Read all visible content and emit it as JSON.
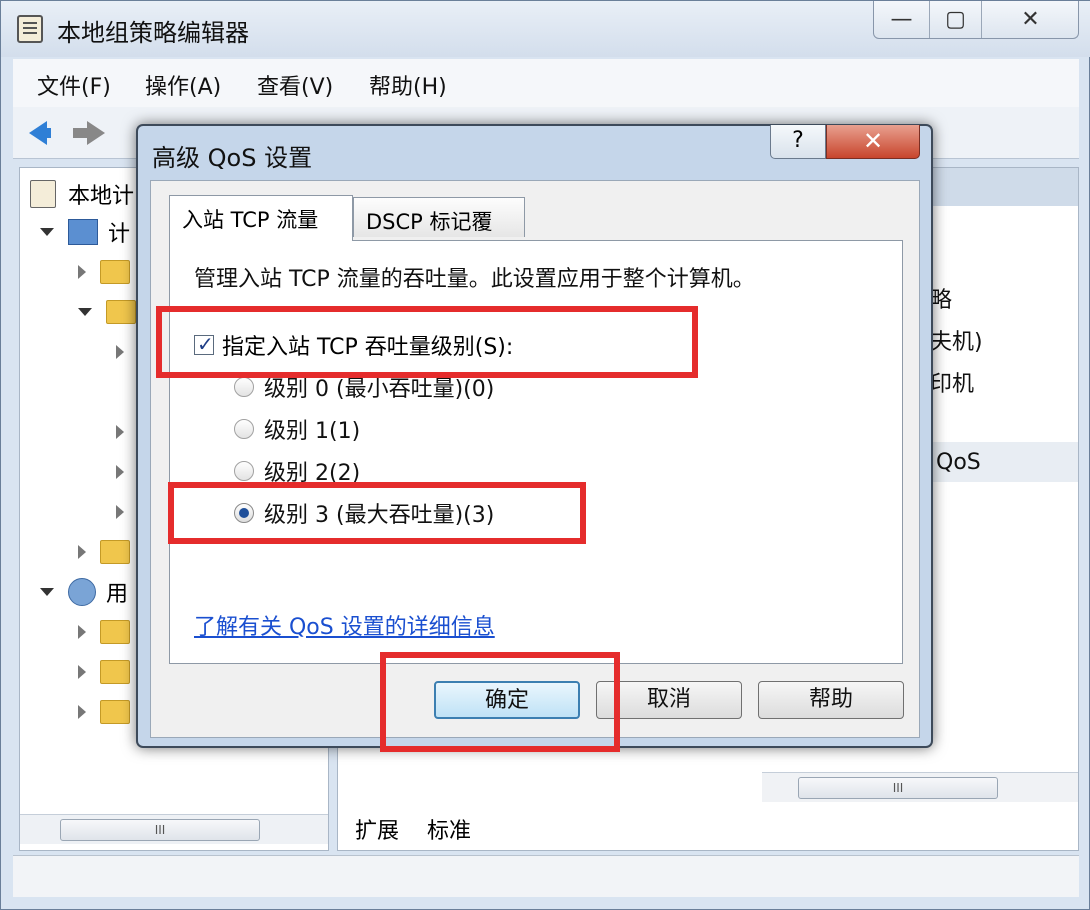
{
  "window": {
    "title": "本地组策略编辑器",
    "controls": {
      "minimize": "—",
      "maximize": "▢",
      "close": "✕"
    }
  },
  "menu": [
    "文件(F)",
    "操作(A)",
    "查看(V)",
    "帮助(H)"
  ],
  "toolbar": {
    "back_icon": "back-arrow-icon",
    "forward_icon": "forward-arrow-icon"
  },
  "tree": {
    "root_label": "本地计",
    "computer_label": "计",
    "user_label": "用",
    "scroll_thumb": "III"
  },
  "right_pane": {
    "text_1": "略",
    "text_2": "夫机)",
    "text_3": "印机",
    "text_4": "QoS",
    "scroll_thumb": "III"
  },
  "bottom_tabs": {
    "extended": "扩展",
    "standard": "标准"
  },
  "dialog": {
    "title": "高级 QoS 设置",
    "help_symbol": "?",
    "close_symbol": "✕",
    "tabs": [
      "入站 TCP 流量",
      "DSCP 标记覆盖"
    ],
    "description": "管理入站 TCP 流量的吞吐量。此设置应用于整个计算机。",
    "checkbox_label": "指定入站 TCP 吞吐量级别(S):",
    "checkbox_checked": true,
    "radio_options": [
      "级别 0 (最小吞吐量)(0)",
      "级别 1(1)",
      "级别 2(2)",
      "级别 3 (最大吞吐量)(3)"
    ],
    "selected_radio_index": 3,
    "link": "了解有关 QoS 设置的详细信息",
    "buttons": {
      "ok": "确定",
      "cancel": "取消",
      "help": "帮助"
    }
  },
  "annotation_color": "#e52c2c"
}
